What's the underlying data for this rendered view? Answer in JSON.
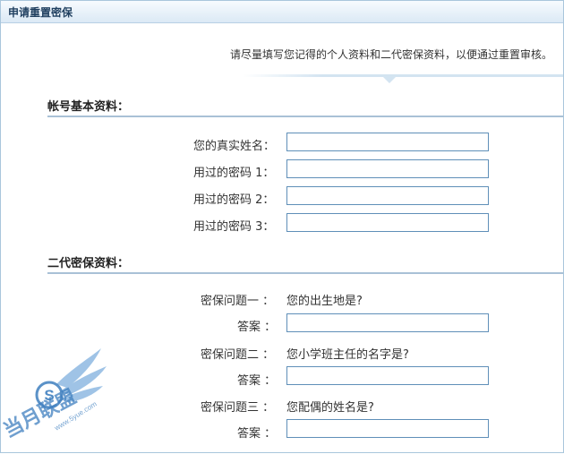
{
  "window": {
    "title": "申请重置密保"
  },
  "notice": "请尽量填写您记得的个人资料和二代密保资料，以便通过重置审核。",
  "account_section": {
    "heading": "帐号基本资料：",
    "fields": [
      {
        "label": "您的真实姓名：",
        "value": ""
      },
      {
        "label": "用过的密码 1：",
        "value": ""
      },
      {
        "label": "用过的密码 2：",
        "value": ""
      },
      {
        "label": "用过的密码 3：",
        "value": ""
      }
    ]
  },
  "security_section": {
    "heading": "二代密保资料：",
    "answer_label": "答案 ：",
    "questions": [
      {
        "label": "密保问题一 ：",
        "question": "您的出生地是?",
        "answer": ""
      },
      {
        "label": "密保问题二 ：",
        "question": "您小学班主任的名字是?",
        "answer": ""
      },
      {
        "label": "密保问题三 ：",
        "question": "您配偶的姓名是?",
        "answer": ""
      }
    ]
  },
  "watermark": {
    "text": "当月联盟",
    "letter": "S",
    "url": "www.5yue.com"
  },
  "colors": {
    "title_bar": "#dbe9f5",
    "input_border": "#5f8fb8",
    "section_rule": "#a9c1d6",
    "watermark": "#3f7fbf"
  }
}
